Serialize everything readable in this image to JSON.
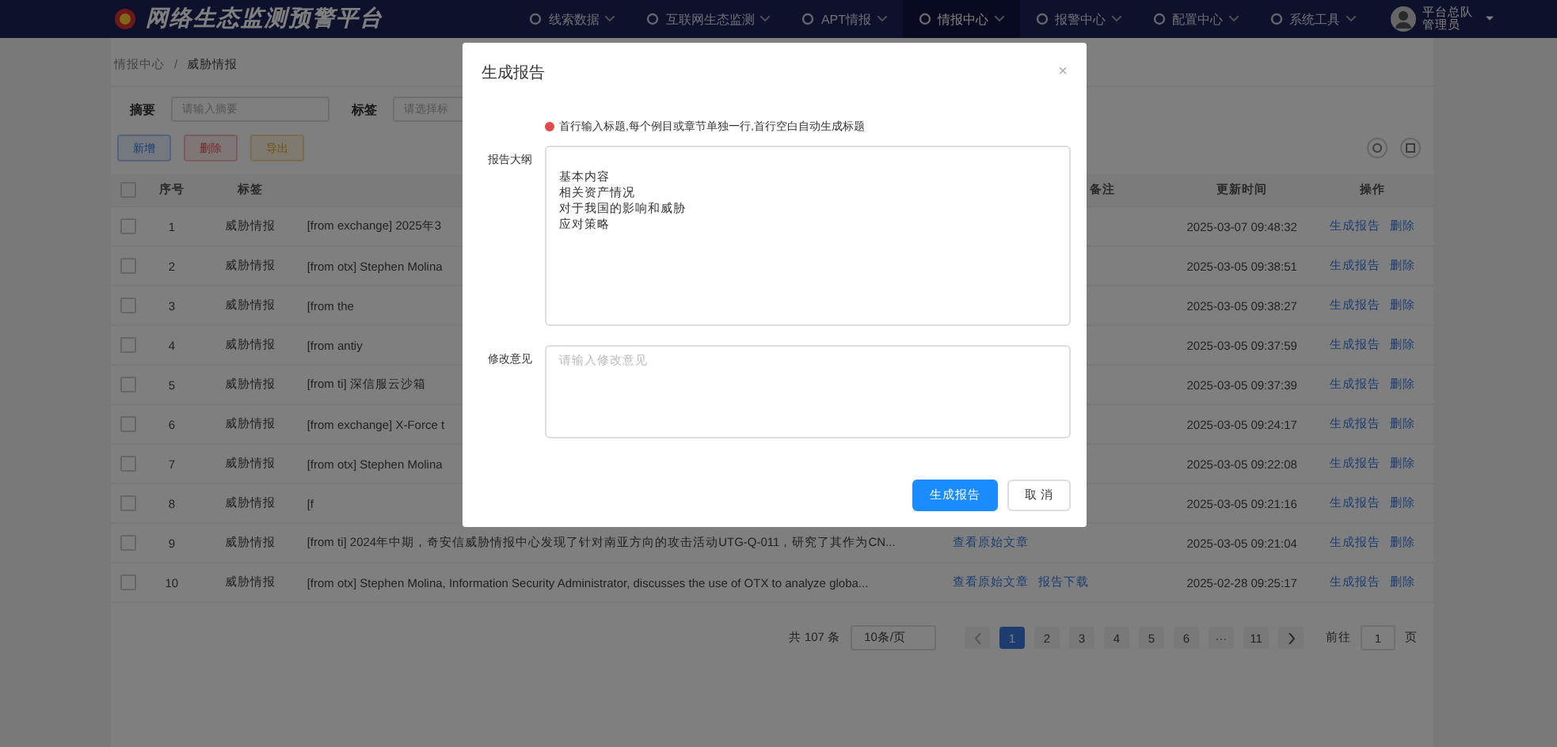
{
  "header": {
    "title": "网络生态监测预警平台",
    "nav": [
      {
        "label": "线索数据",
        "selected": false
      },
      {
        "label": "互联网生态监测",
        "selected": false
      },
      {
        "label": "APT情报",
        "selected": false
      },
      {
        "label": "情报中心",
        "selected": true
      },
      {
        "label": "报警中心",
        "selected": false
      },
      {
        "label": "配置中心",
        "selected": false
      },
      {
        "label": "系统工具",
        "selected": false
      }
    ],
    "user": "平台总队管理员"
  },
  "breadcrumb": [
    "情报中心",
    "/",
    "威胁情报"
  ],
  "filters": [
    {
      "label": "摘要",
      "placeholder": "请输入摘要"
    },
    {
      "label": "标签",
      "placeholder": "请选择标"
    }
  ],
  "toolbar": [
    {
      "kind": "add",
      "label": "新增"
    },
    {
      "kind": "delete",
      "label": "删除"
    },
    {
      "kind": "export",
      "label": "导出"
    }
  ],
  "table": {
    "all_checked": false,
    "columns": [
      "序号",
      "标签",
      null,
      "备注",
      "更新时间",
      "操作"
    ],
    "rows": [
      {
        "index": "1",
        "tag": "威胁情报",
        "title": "[from exchange] 2025年3",
        "time": "2025-03-07 09:48:32",
        "actions": [
          "生成报告",
          "删除"
        ],
        "checked": false
      },
      {
        "index": "2",
        "tag": "威胁情报",
        "title": "[from otx] Stephen Molina",
        "time": "2025-03-05 09:38:51",
        "actions": [
          "生成报告",
          "删除"
        ],
        "checked": false
      },
      {
        "index": "3",
        "tag": "威胁情报",
        "title": "[from the",
        "time": "2025-03-05 09:38:27",
        "actions": [
          "生成报告",
          "删除"
        ],
        "checked": false
      },
      {
        "index": "4",
        "tag": "威胁情报",
        "title": "[from antiy",
        "time": "2025-03-05 09:37:59",
        "actions": [
          "生成报告",
          "删除"
        ],
        "checked": false
      },
      {
        "index": "5",
        "tag": "威胁情报",
        "title": "[from ti] 深信服云沙箱",
        "time": "2025-03-05 09:37:39",
        "actions": [
          "生成报告",
          "删除"
        ],
        "checked": false
      },
      {
        "index": "6",
        "tag": "威胁情报",
        "title": "[from exchange] X-Force t",
        "time": "2025-03-05 09:24:17",
        "actions": [
          "生成报告",
          "删除"
        ],
        "checked": false
      },
      {
        "index": "7",
        "tag": "威胁情报",
        "title": "[from otx] Stephen Molina",
        "time": "2025-03-05 09:22:08",
        "actions": [
          "生成报告",
          "删除"
        ],
        "checked": false
      },
      {
        "index": "8",
        "tag": "威胁情报",
        "title": "[f",
        "time": "2025-03-05 09:21:16",
        "actions": [
          "生成报告",
          "删除"
        ],
        "checked": false
      },
      {
        "index": "9",
        "tag": "威胁情报",
        "title": "[from ti] 2024年中期，奇安信威胁情报中心发现了针对南亚方向的攻击活动UTG-Q-011，研究了其作为CN...",
        "link": "查看原始文章",
        "time": "2025-03-05 09:21:04",
        "actions": [
          "生成报告",
          "删除"
        ],
        "checked": false
      },
      {
        "index": "10",
        "tag": "威胁情报",
        "title": "[from otx] Stephen Molina, Information Security Administrator, discusses the use of OTX to analyze globa...",
        "link": "查看原始文章",
        "note": "报告下载",
        "time": "2025-02-28 09:25:17",
        "actions": [
          "生成报告",
          "删除"
        ],
        "checked": false
      }
    ]
  },
  "pagination": {
    "total": "共 107 条",
    "page_size": "10条/页",
    "pages": [
      {
        "label": "1",
        "selected": true
      },
      {
        "label": "2",
        "selected": false
      },
      {
        "label": "3",
        "selected": false
      },
      {
        "label": "4",
        "selected": false
      },
      {
        "label": "5",
        "selected": false
      },
      {
        "label": "6",
        "selected": false
      },
      {
        "label": "···",
        "selected": false
      },
      {
        "label": "11",
        "selected": false
      }
    ],
    "goto_label": "前往",
    "goto_value": "1",
    "goto_suffix": "页"
  },
  "modal": {
    "title": "生成报告",
    "close": "×",
    "hint": "首行输入标题,每个例目或章节单独一行,首行空白自动生成标题",
    "outline_label": "报告大纲",
    "outline_lines": [
      "基本内容",
      "相关资产情况",
      "对于我国的影响和威胁",
      "应对策略"
    ],
    "comment_label": "修改意见",
    "comment_placeholder": "请输入修改意见",
    "buttons": [
      {
        "kind": "primary",
        "label": "生成报告"
      },
      {
        "kind": "default",
        "label": "取 消"
      }
    ]
  }
}
